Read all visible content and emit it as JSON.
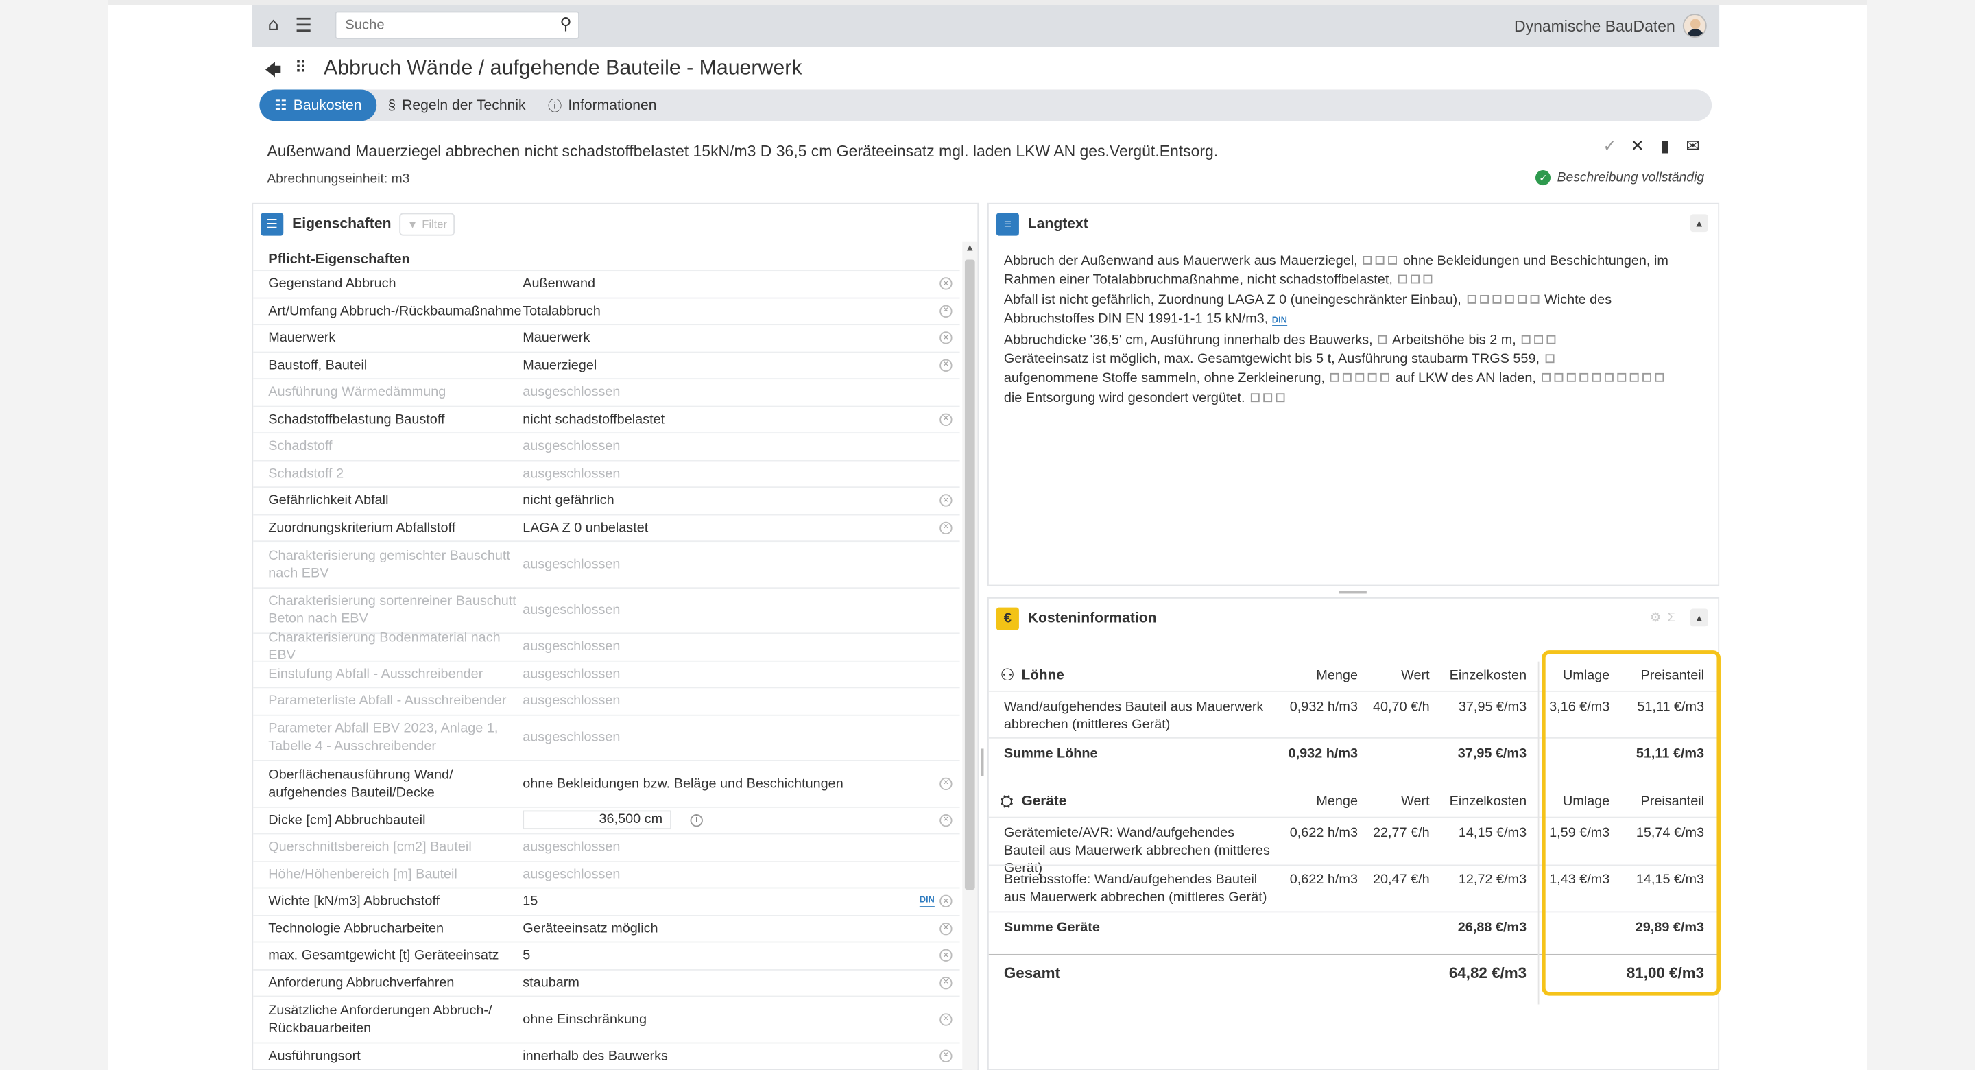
{
  "topbar": {
    "search_placeholder": "Suche",
    "user_name": "Dynamische BauDaten"
  },
  "page": {
    "title": "Abbruch Wände / aufgehende Bauteile - Mauerwerk"
  },
  "tabs": [
    {
      "label": "Baukosten",
      "icon": "list-icon",
      "active": true
    },
    {
      "label": "Regeln der Technik",
      "icon": "paragraph-icon",
      "active": false
    },
    {
      "label": "Informationen",
      "icon": "info-icon",
      "active": false
    }
  ],
  "position": {
    "short_text": "Außenwand Mauerziegel abbrechen nicht schadstoffbelastet 15kN/m3 D 36,5 cm Geräteeinsatz mgl. laden LKW AN ges.Vergüt.Entsorg.",
    "unit_label": "Abrechnungseinheit: m3",
    "status": "Beschreibung vollständig"
  },
  "properties": {
    "title": "Eigenschaften",
    "filter_label": "Filter",
    "section": "Pflicht-Eigenschaften",
    "rows": [
      {
        "key": "Gegenstand Abbruch",
        "value": "Außenwand",
        "disabled": false,
        "remove": true
      },
      {
        "key": "Art/Umfang Abbruch-/Rückbaumaßnahme",
        "value": "Totalabbruch",
        "disabled": false,
        "remove": true
      },
      {
        "key": "Mauerwerk",
        "value": "Mauerwerk",
        "disabled": false,
        "remove": true
      },
      {
        "key": "Baustoff, Bauteil",
        "value": "Mauerziegel",
        "disabled": false,
        "remove": true
      },
      {
        "key": "Ausführung Wärmedämmung",
        "value": "ausgeschlossen",
        "disabled": true,
        "remove": false
      },
      {
        "key": "Schadstoffbelastung Baustoff",
        "value": "nicht schadstoffbelastet",
        "disabled": false,
        "remove": true
      },
      {
        "key": "Schadstoff",
        "value": "ausgeschlossen",
        "disabled": true,
        "remove": false
      },
      {
        "key": "Schadstoff 2",
        "value": "ausgeschlossen",
        "disabled": true,
        "remove": false
      },
      {
        "key": "Gefährlichkeit Abfall",
        "value": "nicht gefährlich",
        "disabled": false,
        "remove": true
      },
      {
        "key": "Zuordnungskriterium Abfallstoff",
        "value": "LAGA Z 0 unbelastet",
        "disabled": false,
        "remove": true
      },
      {
        "key": "Charakterisierung gemischter Bauschutt nach EBV",
        "value": "ausgeschlossen",
        "disabled": true,
        "remove": false
      },
      {
        "key": "Charakterisierung sortenreiner Bauschutt Beton nach EBV",
        "value": "ausgeschlossen",
        "disabled": true,
        "remove": false
      },
      {
        "key": "Charakterisierung Bodenmaterial nach EBV",
        "value": "ausgeschlossen",
        "disabled": true,
        "remove": false
      },
      {
        "key": "Einstufung Abfall - Ausschreibender",
        "value": "ausgeschlossen",
        "disabled": true,
        "remove": false
      },
      {
        "key": "Parameterliste Abfall - Ausschreibender",
        "value": "ausgeschlossen",
        "disabled": true,
        "remove": false
      },
      {
        "key": "Parameter Abfall EBV 2023, Anlage 1, Tabelle 4 - Ausschreibender",
        "value": "ausgeschlossen",
        "disabled": true,
        "remove": false
      },
      {
        "key": "Oberflächenausführung Wand/ aufgehendes Bauteil/Decke",
        "value": "ohne Bekleidungen bzw. Beläge und Beschichtungen",
        "disabled": false,
        "remove": true
      },
      {
        "key": "Dicke [cm] Abbruchbauteil",
        "value": "36,500 cm",
        "disabled": false,
        "remove": true,
        "input": true
      },
      {
        "key": "Querschnittsbereich [cm2] Bauteil",
        "value": "ausgeschlossen",
        "disabled": true,
        "remove": false
      },
      {
        "key": "Höhe/Höhenbereich [m] Bauteil",
        "value": "ausgeschlossen",
        "disabled": true,
        "remove": false
      },
      {
        "key": "Wichte [kN/m3] Abbruchstoff",
        "value": "15",
        "disabled": false,
        "remove": true,
        "din": "DIN"
      },
      {
        "key": "Technologie Abbrucharbeiten",
        "value": "Geräteeinsatz möglich",
        "disabled": false,
        "remove": true
      },
      {
        "key": "max. Gesamtgewicht [t] Geräteeinsatz",
        "value": "5",
        "disabled": false,
        "remove": true
      },
      {
        "key": "Anforderung Abbruchverfahren",
        "value": "staubarm",
        "disabled": false,
        "remove": true
      },
      {
        "key": "Zusätzliche Anforderungen Abbruch-/ Rückbauarbeiten",
        "value": "ohne Einschränkung",
        "disabled": false,
        "remove": true
      },
      {
        "key": "Ausführungsort",
        "value": "innerhalb des Bauwerks",
        "disabled": false,
        "remove": true
      }
    ]
  },
  "langtext": {
    "title": "Langtext",
    "lines": [
      {
        "text": "Abbruch der Außenwand aus Mauerwerk aus Mauerziegel,",
        "boxes": 3,
        "after": "ohne Bekleidungen und Beschichtungen, im"
      },
      {
        "text": "Rahmen einer Totalabbruchmaßnahme, nicht schadstoffbelastet,",
        "boxes": 3,
        "after": ""
      },
      {
        "text": "Abfall ist nicht gefährlich, Zuordnung LAGA Z 0 (uneingeschränkter Einbau),",
        "boxes": 6,
        "after": "Wichte des"
      },
      {
        "text": "Abbruchstoffes DIN EN 1991-1-1 15 kN/m3,",
        "boxes": 0,
        "after": "",
        "din": "DIN"
      },
      {
        "text": "Abbruchdicke '36,5' cm, Ausführung innerhalb des Bauwerks,",
        "boxes": 1,
        "after": "Arbeitshöhe bis 2 m,",
        "boxes2": 3
      },
      {
        "text": "Geräteeinsatz ist möglich, max. Gesamtgewicht bis 5 t, Ausführung staubarm TRGS 559,",
        "boxes": 1,
        "after": ""
      },
      {
        "text": "aufgenommene Stoffe sammeln, ohne Zerkleinerung,",
        "boxes": 5,
        "after": "auf LKW des AN laden,",
        "boxes2": 10
      },
      {
        "text": "die Entsorgung wird gesondert vergütet.",
        "boxes": 3,
        "after": ""
      }
    ]
  },
  "costs": {
    "title": "Kosteninformation",
    "headers": {
      "menge": "Menge",
      "wert": "Wert",
      "einzelkosten": "Einzelkosten",
      "umlage": "Umlage",
      "preisanteil": "Preisanteil"
    },
    "loehne": {
      "label": "Löhne",
      "icon": "worker-icon",
      "items": [
        {
          "name": "Wand/aufgehendes Bauteil aus Mauerwerk abbrechen (mittleres Gerät)",
          "menge": "0,932 h/m3",
          "wert": "40,70 €/h",
          "einzelkosten": "37,95 €/m3",
          "umlage": "3,16 €/m3",
          "preisanteil": "51,11 €/m3"
        }
      ],
      "sum_label": "Summe Löhne",
      "sum_menge": "0,932 h/m3",
      "sum_einzelkosten": "37,95 €/m3",
      "sum_preisanteil": "51,11 €/m3"
    },
    "geraete": {
      "label": "Geräte",
      "icon": "crane-icon",
      "items": [
        {
          "name": "Gerätemiete/AVR: Wand/aufgehendes Bauteil aus Mauerwerk abbrechen (mittleres Gerät)",
          "menge": "0,622 h/m3",
          "wert": "22,77 €/h",
          "einzelkosten": "14,15 €/m3",
          "umlage": "1,59 €/m3",
          "preisanteil": "15,74 €/m3"
        },
        {
          "name": "Betriebsstoffe: Wand/aufgehendes Bauteil aus Mauerwerk abbrechen (mittleres Gerät)",
          "menge": "0,622 h/m3",
          "wert": "20,47 €/h",
          "einzelkosten": "12,72 €/m3",
          "umlage": "1,43 €/m3",
          "preisanteil": "14,15 €/m3"
        }
      ],
      "sum_label": "Summe Geräte",
      "sum_einzelkosten": "26,88 €/m3",
      "sum_preisanteil": "29,89 €/m3"
    },
    "total_label": "Gesamt",
    "total_einzelkosten": "64,82 €/m3",
    "total_preisanteil": "81,00 €/m3"
  },
  "colors": {
    "accent": "#2f7cc0",
    "highlight": "#f5c31a",
    "success": "#2e9a4e"
  }
}
